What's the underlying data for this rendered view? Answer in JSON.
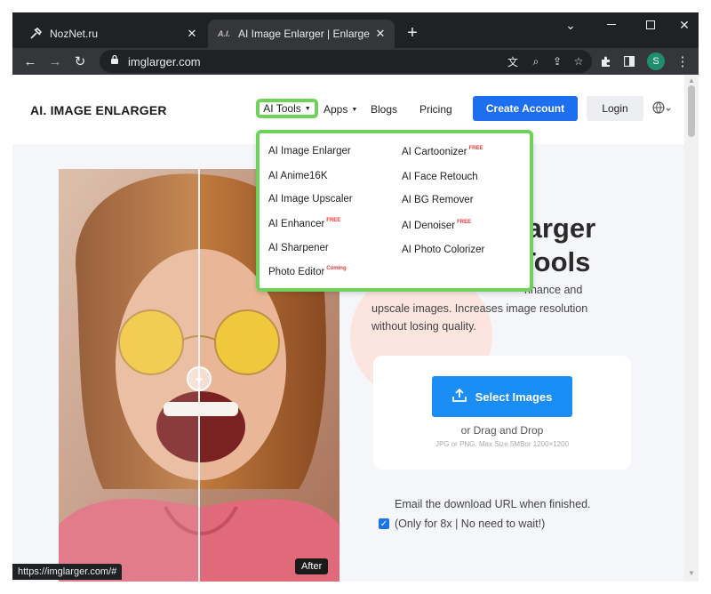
{
  "tabs": [
    {
      "title": "NozNet.ru",
      "icon": "tools-icon",
      "active": false
    },
    {
      "title": "AI Image Enlarger | Enlarge Imag",
      "icon": "ai-favicon",
      "favicon_text": "A.I.",
      "active": true
    }
  ],
  "new_tab_symbol": "+",
  "toolbar": {
    "url": "imglarger.com",
    "profile_initial": "S"
  },
  "header": {
    "logo": "AI. IMAGE ENLARGER",
    "nav": {
      "ai_tools": "AI Tools",
      "apps": "Apps",
      "blogs": "Blogs",
      "pricing": "Pricing"
    },
    "create_account": "Create Account",
    "login": "Login"
  },
  "dropdown": {
    "left": [
      {
        "label": "AI Image Enlarger",
        "tag": ""
      },
      {
        "label": "AI Anime16K",
        "tag": ""
      },
      {
        "label": "AI Image Upscaler",
        "tag": ""
      },
      {
        "label": "AI Enhancer",
        "tag": "FREE"
      },
      {
        "label": "AI Sharpener",
        "tag": ""
      },
      {
        "label": "Photo Editor",
        "tag": "Coming"
      }
    ],
    "right": [
      {
        "label": "AI Cartoonizer",
        "tag": "FREE"
      },
      {
        "label": "AI Face Retouch",
        "tag": ""
      },
      {
        "label": "AI BG Remover",
        "tag": ""
      },
      {
        "label": "AI Denoiser",
        "tag": "FREE"
      },
      {
        "label": "AI Photo Colorizer",
        "tag": ""
      }
    ]
  },
  "hero": {
    "title_line1": "larger",
    "title_line2": "Tools",
    "desc_line1": "nhance and",
    "desc_line2": "upscale images. Increases image resolution",
    "desc_line3": "without losing quality."
  },
  "photo": {
    "after_label": "After"
  },
  "upload": {
    "select_label": "Select Images",
    "drag_label": "or Drag and Drop",
    "hint": "JPG or PNG. Max Size 5MBor 1200×1200"
  },
  "email": {
    "line": "Email the download URL when finished.",
    "checkbox_label": "(Only for 8x | No need to wait!)",
    "checked": true
  },
  "status_url": "https://imglarger.com/#",
  "colors": {
    "accent_green": "#6fd25a",
    "primary_blue": "#1e6ff0",
    "select_blue": "#1a8ef5"
  }
}
